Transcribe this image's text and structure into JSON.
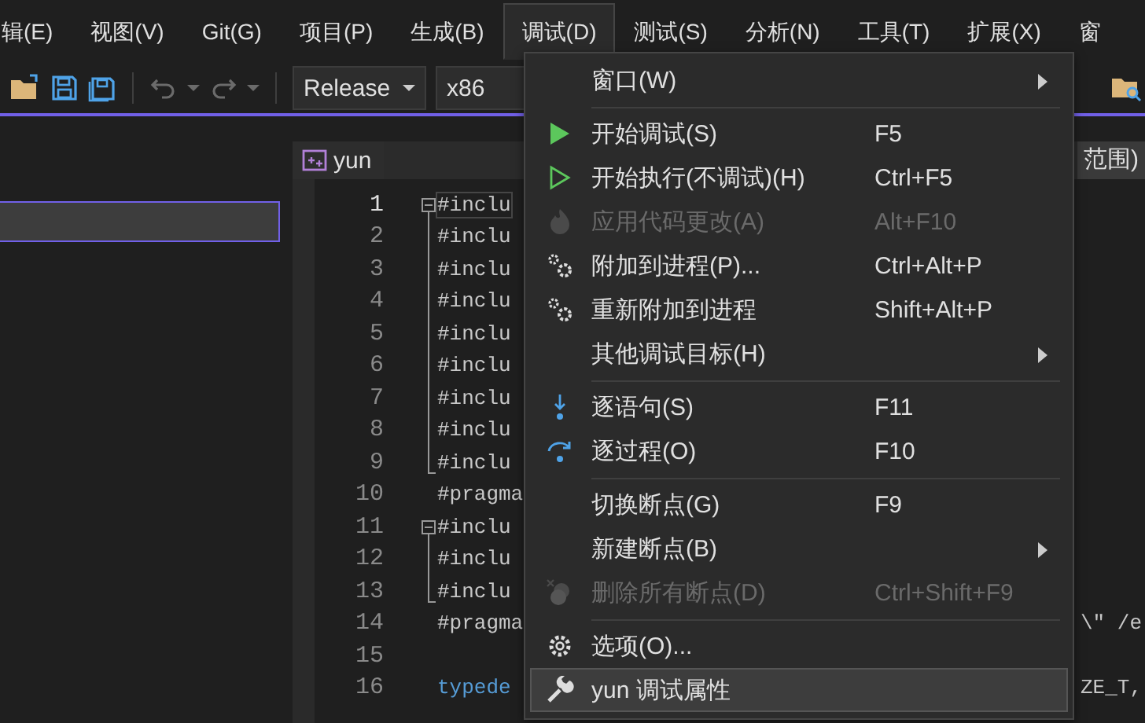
{
  "menu_bar": [
    {
      "label": "辑(E)",
      "selected": false
    },
    {
      "label": "视图(V)",
      "selected": false
    },
    {
      "label": "Git(G)",
      "selected": false
    },
    {
      "label": "项目(P)",
      "selected": false
    },
    {
      "label": "生成(B)",
      "selected": false
    },
    {
      "label": "调试(D)",
      "selected": true
    },
    {
      "label": "测试(S)",
      "selected": false
    },
    {
      "label": "分析(N)",
      "selected": false
    },
    {
      "label": "工具(T)",
      "selected": false
    },
    {
      "label": "扩展(X)",
      "selected": false
    },
    {
      "label": "窗",
      "selected": false
    }
  ],
  "toolbar": {
    "configuration": "Release",
    "platform": "x86"
  },
  "editor_tab": {
    "title": "yun",
    "scope": "范围)"
  },
  "code_lines": [
    {
      "number": "1",
      "code": "#inclu",
      "kind": "fold-start"
    },
    {
      "number": "2",
      "code": "#inclu",
      "kind": "fold-line"
    },
    {
      "number": "3",
      "code": "#inclu",
      "kind": "fold-line"
    },
    {
      "number": "4",
      "code": "#inclu",
      "kind": "fold-line"
    },
    {
      "number": "5",
      "code": "#inclu",
      "kind": "fold-line"
    },
    {
      "number": "6",
      "code": "#inclu",
      "kind": "fold-line"
    },
    {
      "number": "7",
      "code": "#inclu",
      "kind": "fold-line"
    },
    {
      "number": "8",
      "code": "#inclu",
      "kind": "fold-line"
    },
    {
      "number": "9",
      "code": "#inclu",
      "kind": "fold-end"
    },
    {
      "number": "10",
      "code": "#pragma",
      "kind": "plain"
    },
    {
      "number": "11",
      "code": "#inclu",
      "kind": "fold-start"
    },
    {
      "number": "12",
      "code": "#inclu",
      "kind": "fold-line"
    },
    {
      "number": "13",
      "code": "#inclu",
      "kind": "fold-end"
    },
    {
      "number": "14",
      "code": "#pragma",
      "kind": "plain",
      "tail": "\\″ /e"
    },
    {
      "number": "15",
      "kind": "plain"
    },
    {
      "number": "16",
      "code": "typede",
      "kind": "keyword",
      "tail": "ZE_T,"
    }
  ],
  "debug_menu": [
    {
      "kind": "plain",
      "label": "窗口(W)",
      "disabled": false,
      "submenu": true,
      "selected": false
    },
    {
      "kind": "separator"
    },
    {
      "kind": "play",
      "label": "开始调试(S)",
      "shortcut": "F5",
      "disabled": false,
      "submenu": false,
      "selected": false
    },
    {
      "kind": "play-outline",
      "label": "开始执行(不调试)(H)",
      "shortcut": "Ctrl+F5",
      "disabled": false,
      "submenu": false,
      "selected": false
    },
    {
      "kind": "flame",
      "label": "应用代码更改(A)",
      "shortcut": "Alt+F10",
      "disabled": true,
      "submenu": false,
      "selected": false
    },
    {
      "kind": "gears",
      "label": "附加到进程(P)...",
      "shortcut": "Ctrl+Alt+P",
      "disabled": false,
      "submenu": false,
      "selected": false
    },
    {
      "kind": "gears",
      "label": "重新附加到进程",
      "shortcut": "Shift+Alt+P",
      "disabled": false,
      "submenu": false,
      "selected": false
    },
    {
      "kind": "plain",
      "label": "其他调试目标(H)",
      "disabled": false,
      "submenu": true,
      "selected": false
    },
    {
      "kind": "separator"
    },
    {
      "kind": "step-into",
      "label": "逐语句(S)",
      "shortcut": "F11",
      "disabled": false,
      "submenu": false,
      "selected": false
    },
    {
      "kind": "step-over",
      "label": "逐过程(O)",
      "shortcut": "F10",
      "disabled": false,
      "submenu": false,
      "selected": false
    },
    {
      "kind": "separator"
    },
    {
      "kind": "plain",
      "label": "切换断点(G)",
      "shortcut": "F9",
      "disabled": false,
      "submenu": false,
      "selected": false
    },
    {
      "kind": "plain",
      "label": "新建断点(B)",
      "disabled": false,
      "submenu": true,
      "selected": false
    },
    {
      "kind": "breakpoints",
      "label": "删除所有断点(D)",
      "shortcut": "Ctrl+Shift+F9",
      "disabled": true,
      "submenu": false,
      "selected": false
    },
    {
      "kind": "separator"
    },
    {
      "kind": "gear",
      "label": "选项(O)...",
      "disabled": false,
      "submenu": false,
      "selected": false
    },
    {
      "kind": "wrench",
      "label": "yun 调试属性",
      "disabled": false,
      "submenu": false,
      "selected": true
    }
  ]
}
